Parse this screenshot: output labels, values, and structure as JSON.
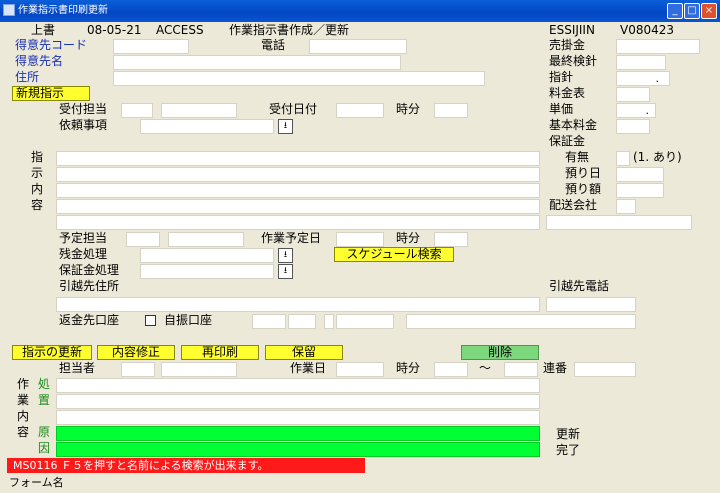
{
  "window": {
    "title": "作業指示書印刷更新",
    "minimize": "_",
    "maximize": "□",
    "close": "×"
  },
  "header": {
    "mode": "上書",
    "date": "08-05-21",
    "app": "ACCESS",
    "screen_title": "作業指示書作成／更新",
    "system_id": "ESSIJIIN",
    "version": "V080423"
  },
  "customer": {
    "code_label": "得意先コード",
    "name_label": "得意先名",
    "address_label": "住所",
    "phone_label": "電話"
  },
  "right_panel": {
    "receivable_label": "売掛金",
    "last_reading_label": "最終検針",
    "meter_label": "指針",
    "meter_value": ".",
    "rate_table_label": "料金表",
    "unit_price_label": "単価",
    "unit_price_value": ".",
    "base_fee_label": "基本料金",
    "deposit_label": "保証金",
    "has_label": "有無",
    "has_hint": "(1. あり)",
    "deposit_date_label": "預り日",
    "deposit_amount_label": "預り額",
    "delivery_company_label": "配送会社",
    "moving_phone_label": "引越先電話"
  },
  "order": {
    "new_button": "新規指示",
    "receiver_label": "受付担当",
    "receive_date_label": "受付日付",
    "time_label": "時分",
    "request_label": "依頼事項",
    "instruction_chars": [
      "指",
      "示",
      "内",
      "容"
    ],
    "plan_person_label": "予定担当",
    "plan_date_label": "作業予定日",
    "plan_time_label": "時分",
    "schedule_search_button": "スケジュール検索",
    "balance_label": "残金処理",
    "deposit_proc_label": "保証金処理",
    "moving_address_label": "引越先住所",
    "refund_account_label": "返金先口座",
    "auto_debit_label": "自振口座"
  },
  "actions": {
    "update": "指示の更新",
    "modify": "内容修正",
    "reprint": "再印刷",
    "hold": "保留",
    "delete": "削除"
  },
  "work": {
    "person_label": "担当者",
    "work_date_label": "作業日",
    "time_label": "時分",
    "tilde": "～",
    "seq_label": "連番",
    "side_chars": [
      "作",
      "業",
      "内",
      "容"
    ],
    "proc_chars": [
      "処",
      "置"
    ],
    "cause_chars": [
      "原",
      "因"
    ],
    "updated_label": "更新",
    "completed_label": "完了"
  },
  "status": {
    "message": "MS0116 Ｆ５を押すと名前による検索が出来ます。",
    "form_name": "フォーム名"
  },
  "colors": {
    "title_blue": "#0446c4",
    "highlight_yellow": "#ffff30",
    "field_green": "#00ff33",
    "message_red": "#ff1a1a",
    "label_blue": "#1a32b4"
  }
}
